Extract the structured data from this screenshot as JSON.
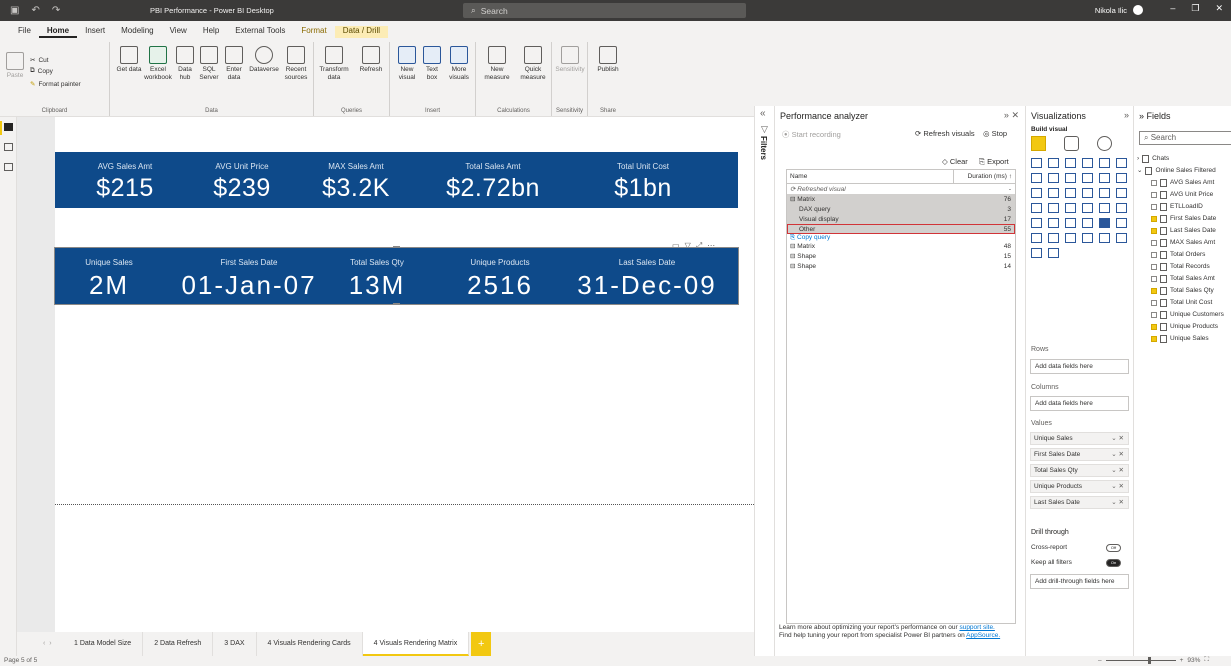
{
  "titlebar": {
    "title": "PBI Performance - Power BI Desktop",
    "search_placeholder": "Search",
    "user": "Nikola Ilic"
  },
  "menu": [
    {
      "label": "File",
      "state": "normal"
    },
    {
      "label": "Home",
      "state": "active"
    },
    {
      "label": "Insert",
      "state": "normal"
    },
    {
      "label": "Modeling",
      "state": "normal"
    },
    {
      "label": "View",
      "state": "normal"
    },
    {
      "label": "Help",
      "state": "normal"
    },
    {
      "label": "External Tools",
      "state": "normal"
    },
    {
      "label": "Format",
      "state": "ctx"
    },
    {
      "label": "Data / Drill",
      "state": "ctxbox"
    }
  ],
  "ribbon": {
    "clipboard": {
      "label": "Clipboard",
      "paste": "Paste",
      "cut": "Cut",
      "copy": "Copy",
      "format_painter": "Format painter"
    },
    "data": {
      "label": "Data",
      "get_data": "Get data",
      "excel": "Excel workbook",
      "data_hub": "Data hub",
      "sql": "SQL Server",
      "enter_data": "Enter data",
      "dataverse": "Dataverse",
      "recent": "Recent sources"
    },
    "queries": {
      "label": "Queries",
      "transform": "Transform data",
      "refresh": "Refresh"
    },
    "insert": {
      "label": "Insert",
      "new_visual": "New visual",
      "text_box": "Text box",
      "more": "More visuals"
    },
    "calculations": {
      "label": "Calculations",
      "new_measure": "New measure",
      "quick_measure": "Quick measure"
    },
    "sensitivity": {
      "label": "Sensitivity",
      "btn": "Sensitivity"
    },
    "share": {
      "label": "Share",
      "publish": "Publish"
    }
  },
  "cards_top": [
    {
      "label": "AVG Sales Amt",
      "value": "$215"
    },
    {
      "label": "AVG Unit Price",
      "value": "$239"
    },
    {
      "label": "MAX Sales Amt",
      "value": "$3.2K"
    },
    {
      "label": "Total Sales Amt",
      "value": "$2.72bn"
    },
    {
      "label": "Total Unit Cost",
      "value": "$1bn"
    }
  ],
  "cards_bottom": [
    {
      "label": "Unique Sales",
      "value": "2M"
    },
    {
      "label": "First Sales Date",
      "value": "01-Jan-07"
    },
    {
      "label": "Total Sales Qty",
      "value": "13M"
    },
    {
      "label": "Unique Products",
      "value": "2516"
    },
    {
      "label": "Last Sales Date",
      "value": "31-Dec-09"
    }
  ],
  "page_tabs": [
    {
      "label": "1 Data Model Size",
      "active": false
    },
    {
      "label": "2 Data Refresh",
      "active": false
    },
    {
      "label": "3 DAX",
      "active": false
    },
    {
      "label": "4 Visuals Rendering Cards",
      "active": false
    },
    {
      "label": "4 Visuals Rendering Matrix",
      "active": true
    }
  ],
  "status": {
    "page": "Page 5 of 5",
    "zoom": "93%"
  },
  "filters_label": "Filters",
  "performance": {
    "title": "Performance analyzer",
    "start_recording": "Start recording",
    "refresh_visuals": "Refresh visuals",
    "stop": "Stop",
    "clear": "Clear",
    "export": "Export",
    "col_name": "Name",
    "col_duration": "Duration (ms)",
    "rows": [
      {
        "name": "Refreshed visual",
        "duration": "-",
        "style": "italic"
      },
      {
        "name": "Matrix",
        "duration": "76",
        "style": "sel"
      },
      {
        "name": "DAX query",
        "duration": "3",
        "style": "sel-ind"
      },
      {
        "name": "Visual display",
        "duration": "17",
        "style": "sel-ind"
      },
      {
        "name": "Other",
        "duration": "55",
        "style": "sel-ind-hl"
      },
      {
        "name": "Copy query",
        "duration": "",
        "style": "link"
      },
      {
        "name": "Matrix",
        "duration": "48",
        "style": "normal"
      },
      {
        "name": "Shape",
        "duration": "15",
        "style": "normal"
      },
      {
        "name": "Shape",
        "duration": "14",
        "style": "normal"
      }
    ],
    "footer_1": "Learn more about optimizing your report's performance on our",
    "footer_link1": "support site.",
    "footer_2": "Find help tuning your report from specialist Power BI partners on",
    "footer_link2": "AppSource."
  },
  "visualizations": {
    "title": "Visualizations",
    "build_visual": "Build visual",
    "rows_label": "Rows",
    "rows_placeholder": "Add data fields here",
    "columns_label": "Columns",
    "columns_placeholder": "Add data fields here",
    "values_label": "Values",
    "values": [
      "Unique Sales",
      "First Sales Date",
      "Total Sales Qty",
      "Unique Products",
      "Last Sales Date"
    ],
    "drill_label": "Drill through",
    "cross_report": "Cross-report",
    "cross_report_state": "Off",
    "keep_filters": "Keep all filters",
    "keep_filters_state": "On",
    "drill_placeholder": "Add drill-through fields here"
  },
  "fields": {
    "title": "Fields",
    "search_placeholder": "Search",
    "tables": [
      {
        "name": "Chats",
        "expanded": false
      },
      {
        "name": "Online Sales Filtered",
        "expanded": true
      }
    ],
    "items": [
      {
        "name": "AVG Sales Amt",
        "checked": false
      },
      {
        "name": "AVG Unit Price",
        "checked": false
      },
      {
        "name": "ETLLoadID",
        "checked": false
      },
      {
        "name": "First Sales Date",
        "checked": true
      },
      {
        "name": "Last Sales Date",
        "checked": true
      },
      {
        "name": "MAX Sales Amt",
        "checked": false
      },
      {
        "name": "Total Orders",
        "checked": false
      },
      {
        "name": "Total Records",
        "checked": false
      },
      {
        "name": "Total Sales Amt",
        "checked": false
      },
      {
        "name": "Total Sales Qty",
        "checked": true
      },
      {
        "name": "Total Unit Cost",
        "checked": false
      },
      {
        "name": "Unique Customers",
        "checked": false
      },
      {
        "name": "Unique Products",
        "checked": true
      },
      {
        "name": "Unique Sales",
        "checked": true
      }
    ]
  }
}
